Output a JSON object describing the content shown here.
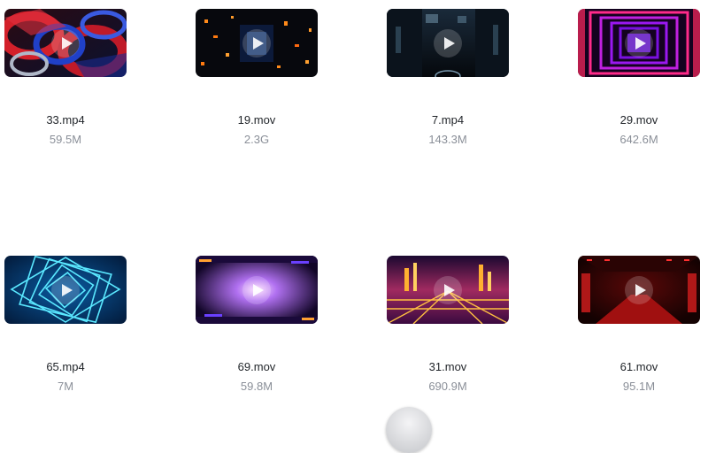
{
  "files": [
    {
      "name": "33.mp4",
      "size": "59.5M",
      "thumbnail": "red-blue-chain-links"
    },
    {
      "name": "19.mov",
      "size": "2.3G",
      "thumbnail": "dark-orange-corridor"
    },
    {
      "name": "7.mp4",
      "size": "143.3M",
      "thumbnail": "dark-city-tunnel"
    },
    {
      "name": "29.mov",
      "size": "642.6M",
      "thumbnail": "purple-neon-frames"
    },
    {
      "name": "65.mp4",
      "size": "7M",
      "thumbnail": "cyan-spiral-squares"
    },
    {
      "name": "69.mov",
      "size": "59.8M",
      "thumbnail": "purple-light-tunnel"
    },
    {
      "name": "31.mov",
      "size": "690.9M",
      "thumbnail": "golden-neon-city"
    },
    {
      "name": "61.mov",
      "size": "95.1M",
      "thumbnail": "red-lit-tunnel"
    }
  ],
  "play_icon": "play-icon",
  "loading_icon": "loading-spinner-icon"
}
